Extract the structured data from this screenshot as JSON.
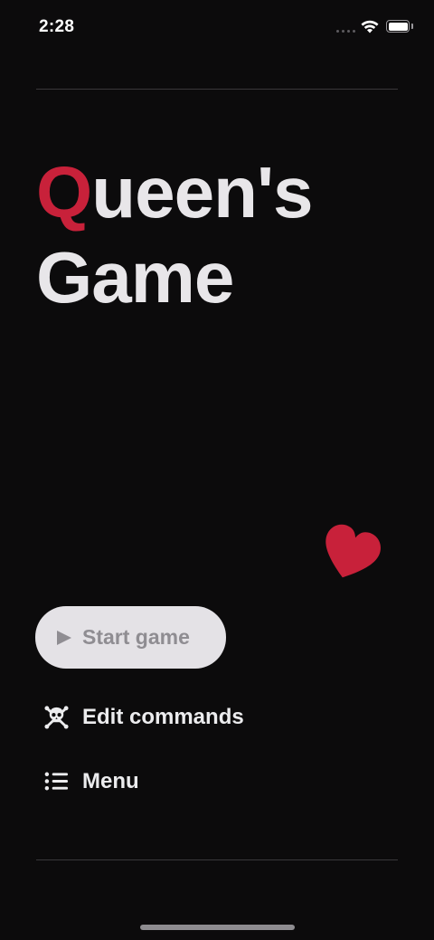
{
  "status_bar": {
    "time": "2:28"
  },
  "title": {
    "first_letter": "Q",
    "line1_rest": "ueen's",
    "line2": "Game"
  },
  "start_button": {
    "label": "Start game"
  },
  "edit_commands": {
    "label": "Edit commands"
  },
  "menu": {
    "label": "Menu"
  },
  "colors": {
    "accent": "#c8213a",
    "background": "#0c0b0c",
    "button": "#e4e2e6"
  },
  "icons": [
    "wifi-icon",
    "battery-icon",
    "heart-icon",
    "play-icon",
    "skull-crossbones-icon",
    "list-icon"
  ]
}
